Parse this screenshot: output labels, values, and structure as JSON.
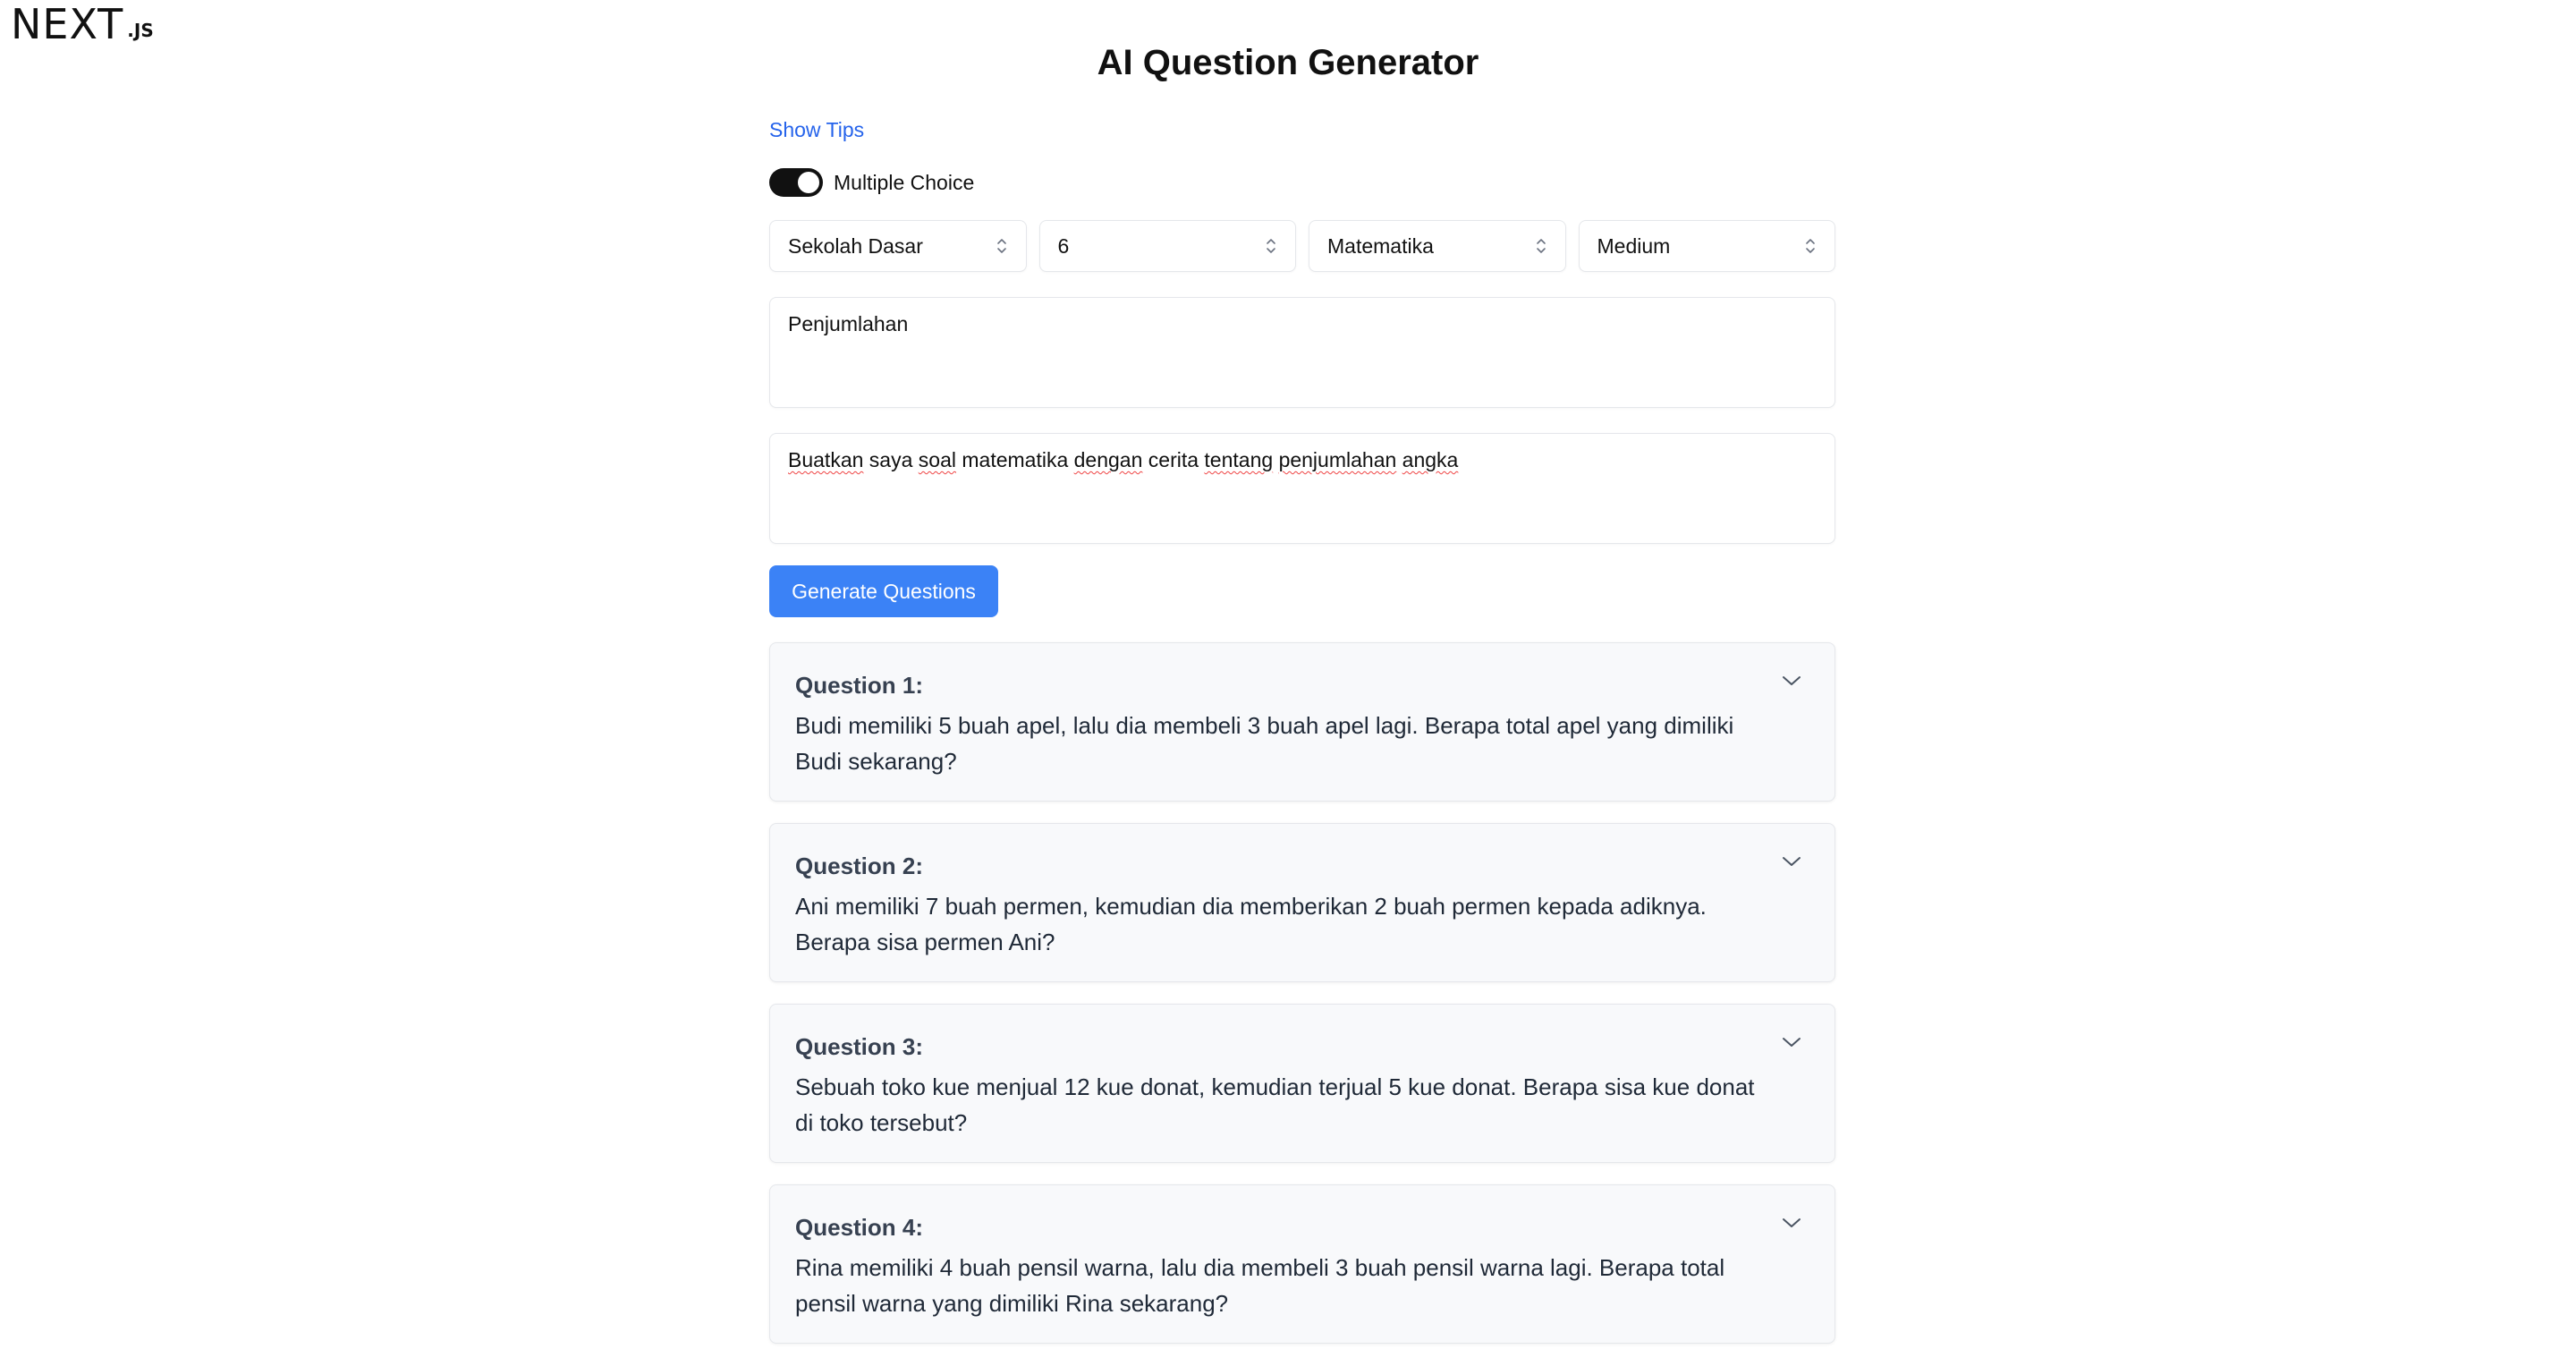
{
  "logo": {
    "mark": "NEXT",
    "sub": ".JS"
  },
  "page": {
    "title": "AI Question Generator"
  },
  "tips": {
    "label": "Show Tips"
  },
  "toggle": {
    "label": "Multiple Choice",
    "on": true
  },
  "selects": [
    {
      "value": "Sekolah Dasar"
    },
    {
      "value": "6"
    },
    {
      "value": "Matematika"
    },
    {
      "value": "Medium"
    }
  ],
  "topic": {
    "value": "Penjumlahan"
  },
  "prompt": {
    "words": [
      "Buatkan",
      "saya",
      "soal",
      "matematika",
      "dengan",
      "cerita",
      "tentang",
      "penjumlahan",
      "angka"
    ]
  },
  "generate": {
    "label": "Generate Questions"
  },
  "questions": [
    {
      "title": "Question 1:",
      "text": "Budi memiliki 5 buah apel, lalu dia membeli 3 buah apel lagi. Berapa total apel yang dimiliki Budi sekarang?"
    },
    {
      "title": "Question 2:",
      "text": "Ani memiliki 7 buah permen, kemudian dia memberikan 2 buah permen kepada adiknya. Berapa sisa permen Ani?"
    },
    {
      "title": "Question 3:",
      "text": "Sebuah toko kue menjual 12 kue donat, kemudian terjual 5 kue donat. Berapa sisa kue donat di toko tersebut?"
    },
    {
      "title": "Question 4:",
      "text": "Rina memiliki 4 buah pensil warna, lalu dia membeli 3 buah pensil warna lagi. Berapa total pensil warna yang dimiliki Rina sekarang?"
    }
  ],
  "colors": {
    "accent": "#3b82f6",
    "link": "#2563eb",
    "card_bg": "#f8f9fb"
  }
}
